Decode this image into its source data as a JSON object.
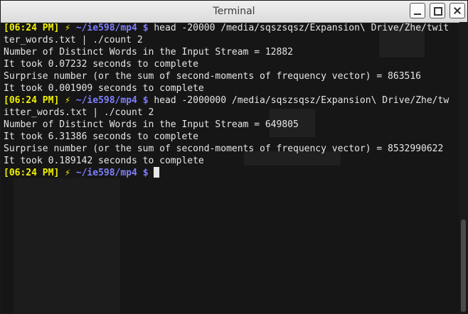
{
  "window": {
    "title": "Terminal"
  },
  "prompt": {
    "time": "[06:24 PM]",
    "bolt": "⚡",
    "path": "~/ie598/mp4",
    "symbol": "$"
  },
  "lines": [
    {
      "type": "prompt",
      "cmd": "head -20000 /media/sqszsqsz/Expansion\\ Drive/Zhe/twit"
    },
    {
      "type": "output",
      "text": "ter_words.txt | ./count 2"
    },
    {
      "type": "output",
      "text": "Number of Distinct Words in the Input Stream = 12882"
    },
    {
      "type": "output",
      "text": "It took 0.07232 seconds to complete"
    },
    {
      "type": "output",
      "text": "Surprise number (or the sum of second-moments of frequency vector) = 863516"
    },
    {
      "type": "output",
      "text": "It took 0.001909 seconds to complete"
    },
    {
      "type": "prompt",
      "cmd": "head -2000000 /media/sqszsqsz/Expansion\\ Drive/Zhe/tw"
    },
    {
      "type": "output",
      "text": "itter_words.txt | ./count 2"
    },
    {
      "type": "output",
      "text": "Number of Distinct Words in the Input Stream = 649805"
    },
    {
      "type": "output",
      "text": "It took 6.31386 seconds to complete"
    },
    {
      "type": "output",
      "text": "Surprise number (or the sum of second-moments of frequency vector) = 8532990622"
    },
    {
      "type": "output",
      "text": "It took 0.189142 seconds to complete"
    },
    {
      "type": "prompt",
      "cmd": ""
    }
  ],
  "colors": {
    "time": "#f0f000",
    "path": "#7f7fff",
    "text": "#e6e6e6",
    "background": "#141414"
  }
}
